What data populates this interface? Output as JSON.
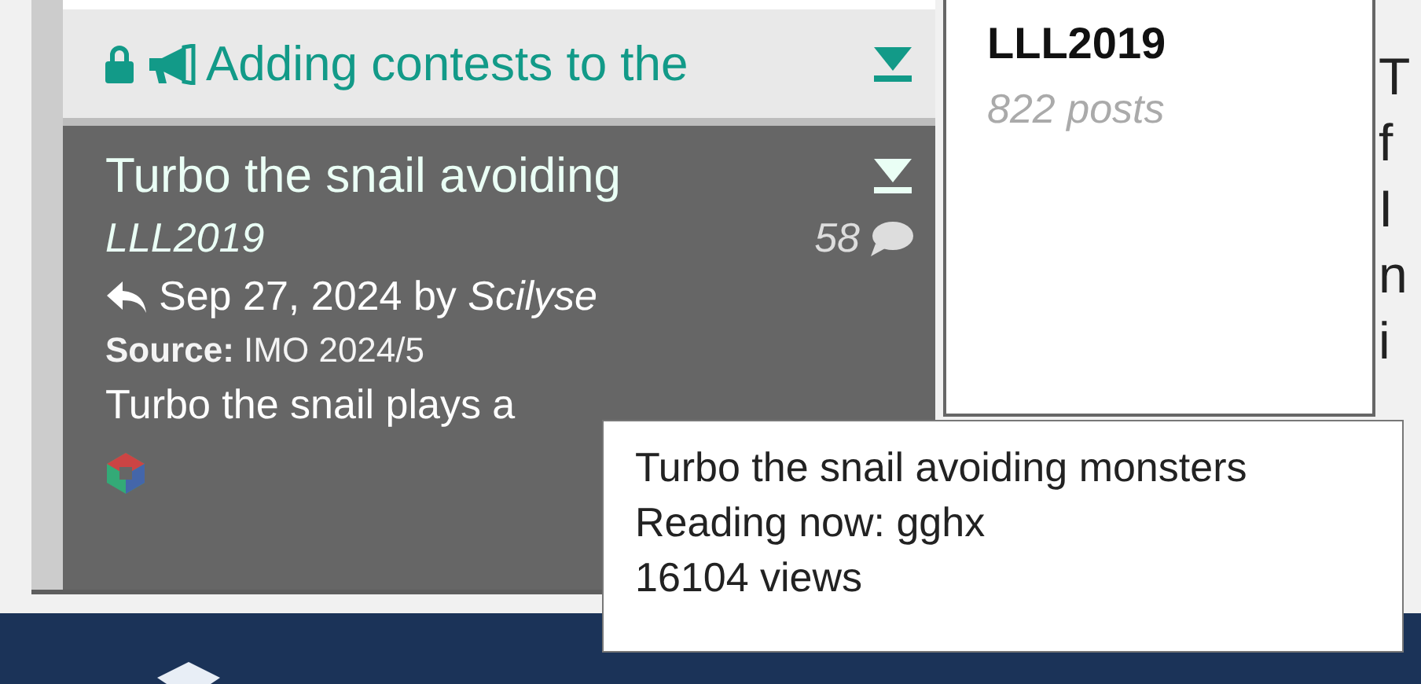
{
  "topics": [
    {
      "kind": "announcement",
      "title": "Adding contests to the",
      "locked": true,
      "selected": false
    },
    {
      "kind": "topic",
      "title": "Turbo the snail avoiding",
      "author": "LLL2019",
      "replies": "58",
      "last_post_date": "Sep 27, 2024",
      "last_post_by_label": "by",
      "last_poster": "Scilyse",
      "source_label": "Source:",
      "source": "IMO 2024/5",
      "preview": "Turbo the snail plays a",
      "selected": true
    }
  ],
  "author_panel": {
    "username": "LLL2019",
    "posts": "822 posts"
  },
  "post_body_edge": [
    "T",
    "f",
    "I",
    "n",
    "i"
  ],
  "tooltip": {
    "lines": [
      "Turbo the snail avoiding monsters",
      "Reading now: gghx",
      "16104 views"
    ]
  }
}
